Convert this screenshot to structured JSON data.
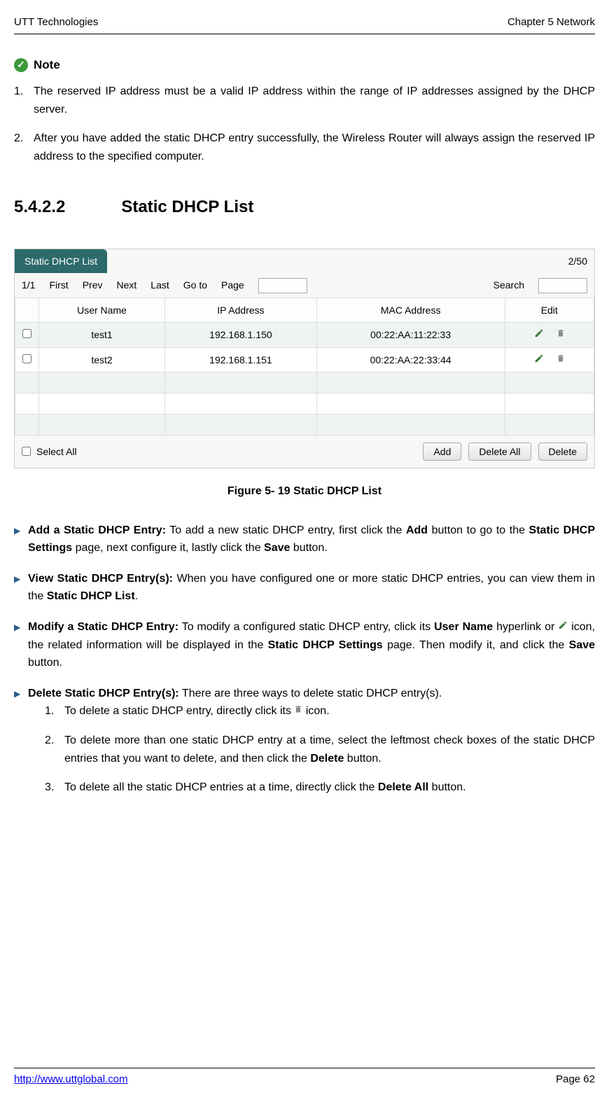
{
  "header": {
    "left": "UTT Technologies",
    "right": "Chapter 5 Network"
  },
  "note": {
    "label": "Note",
    "items": [
      {
        "num": "1.",
        "text": "The reserved IP address must be a valid IP address within the range of IP addresses assigned by the DHCP server."
      },
      {
        "num": "2.",
        "text": "After you have added the static DHCP entry successfully, the Wireless Router will always assign the reserved IP address to the specified computer."
      }
    ]
  },
  "section": {
    "number": "5.4.2.2",
    "title": "Static DHCP List"
  },
  "dhcp": {
    "tab_label": "Static DHCP List",
    "count": "2/50",
    "pager_pos": "1/1",
    "first": "First",
    "prev": "Prev",
    "next": "Next",
    "last": "Last",
    "goto": "Go to",
    "page_lbl": "Page",
    "search": "Search",
    "cols": {
      "user": "User Name",
      "ip": "IP Address",
      "mac": "MAC Address",
      "edit": "Edit"
    },
    "rows": [
      {
        "user": "test1",
        "ip": "192.168.1.150",
        "mac": "00:22:AA:11:22:33"
      },
      {
        "user": "test2",
        "ip": "192.168.1.151",
        "mac": "00:22:AA:22:33:44"
      }
    ],
    "select_all": "Select All",
    "add_btn": "Add",
    "delete_all_btn": "Delete All",
    "delete_btn": "Delete"
  },
  "figure_caption": "Figure 5- 19 Static DHCP List",
  "bullets": {
    "add": {
      "bold1": "Add a Static DHCP Entry:",
      "t1": " To add a new static DHCP entry, first click the ",
      "bold2": "Add",
      "t2": " button to go to the ",
      "bold3": "Static DHCP Settings",
      "t3": " page, next configure it, lastly click the ",
      "bold4": "Save",
      "t4": " button."
    },
    "view": {
      "bold1": "View Static DHCP Entry(s):",
      "t1": " When you have configured one or more static DHCP entries, you can view them in the ",
      "bold2": "Static DHCP List",
      "t2": "."
    },
    "modify": {
      "bold1": "Modify a Static DHCP Entry:",
      "t1": " To modify a configured static DHCP entry, click its ",
      "bold2": "User Name",
      "t2": " hyperlink or ",
      "t3": " icon, the related information will be displayed in the ",
      "bold3": "Static DHCP Settings",
      "t4": " page. Then modify it, and click the ",
      "bold4": "Save",
      "t5": " button."
    },
    "delete": {
      "bold1": "Delete Static DHCP Entry(s):",
      "t1": " There are three ways to delete static DHCP entry(s).",
      "sub": [
        {
          "num": "1.",
          "pre": "To delete a static DHCP entry, directly click its ",
          "post": " icon."
        },
        {
          "num": "2.",
          "pre": "To delete more than one static DHCP entry at a time, select the leftmost check boxes of the static DHCP entries that you want to delete, and then click the ",
          "bold": "Delete",
          "post": " button."
        },
        {
          "num": "3.",
          "pre": "To delete all the static DHCP entries at a time, directly click the ",
          "bold": "Delete All",
          "post": " button."
        }
      ]
    }
  },
  "footer": {
    "url": "http://www.uttglobal.com",
    "page": "Page 62"
  }
}
